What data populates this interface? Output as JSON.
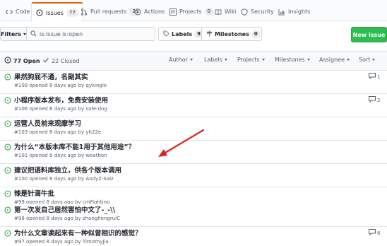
{
  "nav": {
    "tabs": [
      {
        "label": "Code",
        "icon": "code-icon",
        "count": ""
      },
      {
        "label": "Issues",
        "icon": "issue-opened-icon",
        "count": "77"
      },
      {
        "label": "Pull requests",
        "icon": "git-pull-request-icon",
        "count": "25"
      },
      {
        "label": "Actions",
        "icon": "play-icon",
        "count": ""
      },
      {
        "label": "Projects",
        "icon": "project-icon",
        "count": "0"
      },
      {
        "label": "Wiki",
        "icon": "book-icon",
        "count": ""
      },
      {
        "label": "Security",
        "icon": "shield-icon",
        "count": ""
      },
      {
        "label": "Insights",
        "icon": "graph-icon",
        "count": ""
      }
    ]
  },
  "subnav": {
    "filters_label": "Filters",
    "search_value": "is:issue is:open",
    "labels_label": "Labels",
    "labels_count": "9",
    "milestones_label": "Milestones",
    "milestones_count": "0",
    "new_issue_label": "New issue"
  },
  "header": {
    "open_label": "77 Open",
    "closed_label": "22 Closed",
    "author": "Author",
    "labels": "Labels",
    "projects": "Projects",
    "milestones": "Milestones",
    "assignee": "Assignee",
    "sort": "Sort"
  },
  "issues": [
    {
      "title": "果然狗屁不通，名副其实",
      "meta": "#109 opened 8 days ago by qykingle",
      "comments": "1"
    },
    {
      "title": "小程序版本发布，免费安装使用",
      "meta": "#106 opened 8 days ago by safe-dog",
      "comments": "2"
    },
    {
      "title": "运营人员前来观摩学习",
      "meta": "#103 opened 8 days ago by yh22e",
      "comments": ""
    },
    {
      "title": "为什么“本版本库不能1用于其他用途”？",
      "meta": "#101 opened 8 days ago by weathon",
      "comments": ""
    },
    {
      "title": "建议把语料库独立，供各个版本调用",
      "meta": "#100 opened 8 days ago by AndyZ-Salz",
      "comments": ""
    },
    {
      "title": "辣是针滴牛批",
      "meta": "#99 opened 8 days ago by cmFighting",
      "comments": ""
    },
    {
      "title": "第一次发自己居然害怕中文了-_-\\\\",
      "meta": "#98 opened 8 days ago by zhanghengruiC",
      "comments": ""
    },
    {
      "title": "为什么文章读起来有一种似曾相识的感觉？",
      "meta": "#97 opened 8 days ago by TimothyJia",
      "comments": "6"
    }
  ],
  "colors": {
    "open_green": "#28a745",
    "new_issue_green": "#2cbe4e",
    "selected_tab_orange": "#e36209",
    "annotation_red": "#e02020"
  }
}
